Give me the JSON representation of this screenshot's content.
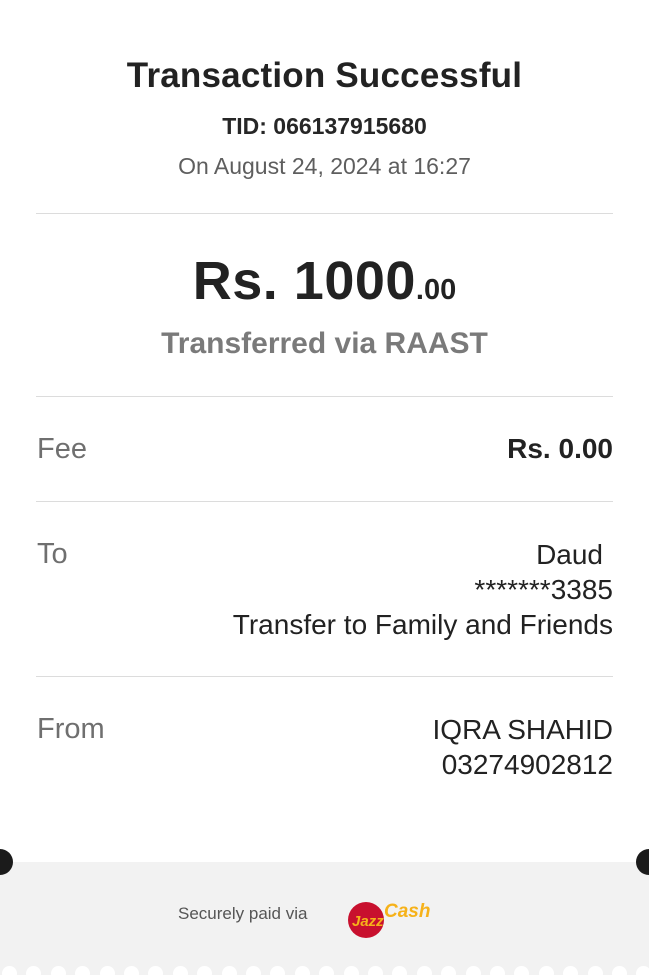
{
  "header": {
    "title": "Transaction Successful",
    "tid": "TID: 066137915680",
    "date": "On August 24, 2024 at 16:27"
  },
  "amount": {
    "main": "Rs. 1000",
    "cents": ".00",
    "via": "Transferred via RAAST"
  },
  "fee": {
    "label": "Fee",
    "value": "Rs. 0.00"
  },
  "to": {
    "label": "To",
    "name": "Daud",
    "account": "*******3385",
    "purpose": "Transfer to Family and Friends"
  },
  "from": {
    "label": "From",
    "name": "IQRA SHAHID",
    "number": "03274902812"
  },
  "footer": {
    "text": "Securely paid via",
    "logo_text": "Jazz Cash"
  },
  "colors": {
    "logo_red": "#c8102e",
    "logo_yellow": "#f6b21a",
    "footer_bg": "#f2f2f2"
  }
}
